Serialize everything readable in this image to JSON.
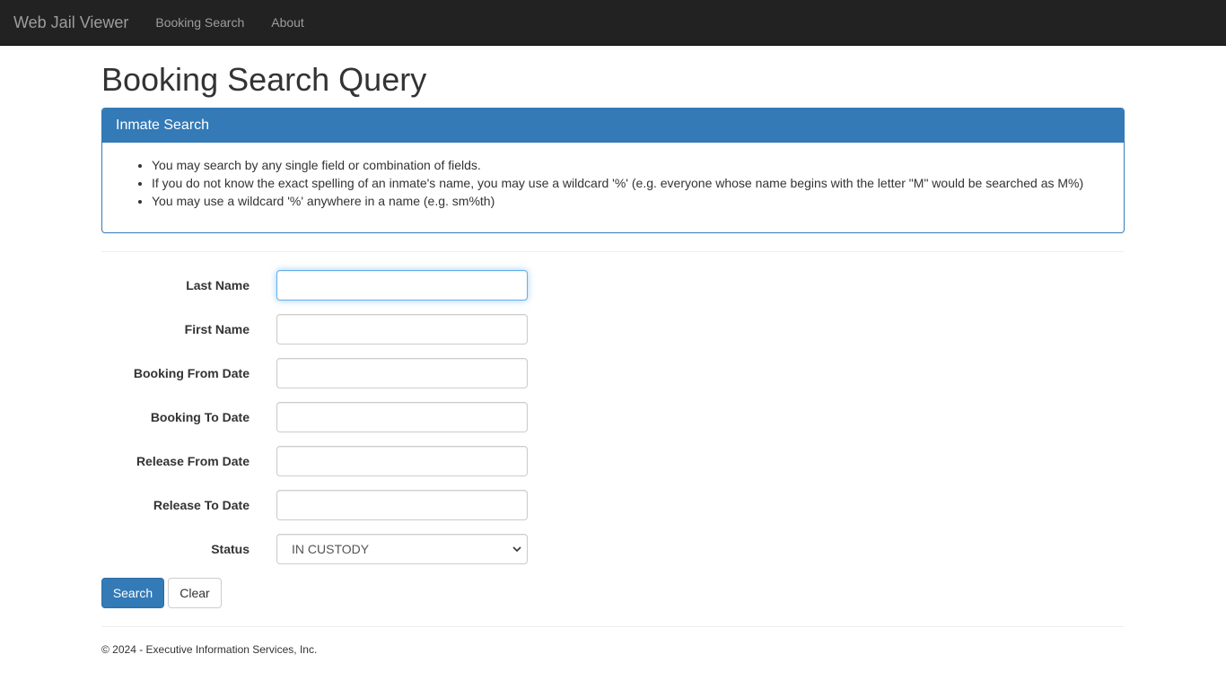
{
  "navbar": {
    "brand": "Web Jail Viewer",
    "links": [
      "Booking Search",
      "About"
    ]
  },
  "page": {
    "title": "Booking Search Query"
  },
  "panel": {
    "heading": "Inmate Search",
    "instructions": [
      "You may search by any single field or combination of fields.",
      "If you do not know the exact spelling of an inmate's name, you may use a wildcard '%' (e.g. everyone whose name begins with the letter \"M\" would be searched as M%)",
      "You may use a wildcard '%' anywhere in a name (e.g. sm%th)"
    ]
  },
  "form": {
    "fields": [
      {
        "label": "Last Name",
        "value": ""
      },
      {
        "label": "First Name",
        "value": ""
      },
      {
        "label": "Booking From Date",
        "value": ""
      },
      {
        "label": "Booking To Date",
        "value": ""
      },
      {
        "label": "Release From Date",
        "value": ""
      },
      {
        "label": "Release To Date",
        "value": ""
      }
    ],
    "status": {
      "label": "Status",
      "selected": "IN CUSTODY"
    },
    "search_label": "Search",
    "clear_label": "Clear"
  },
  "footer": {
    "text": "© 2024 - Executive Information Services, Inc."
  },
  "colors": {
    "navbar_bg": "#222222",
    "nav_text": "#9d9d9d",
    "primary": "#337ab7",
    "focus_border": "#66afe9"
  }
}
